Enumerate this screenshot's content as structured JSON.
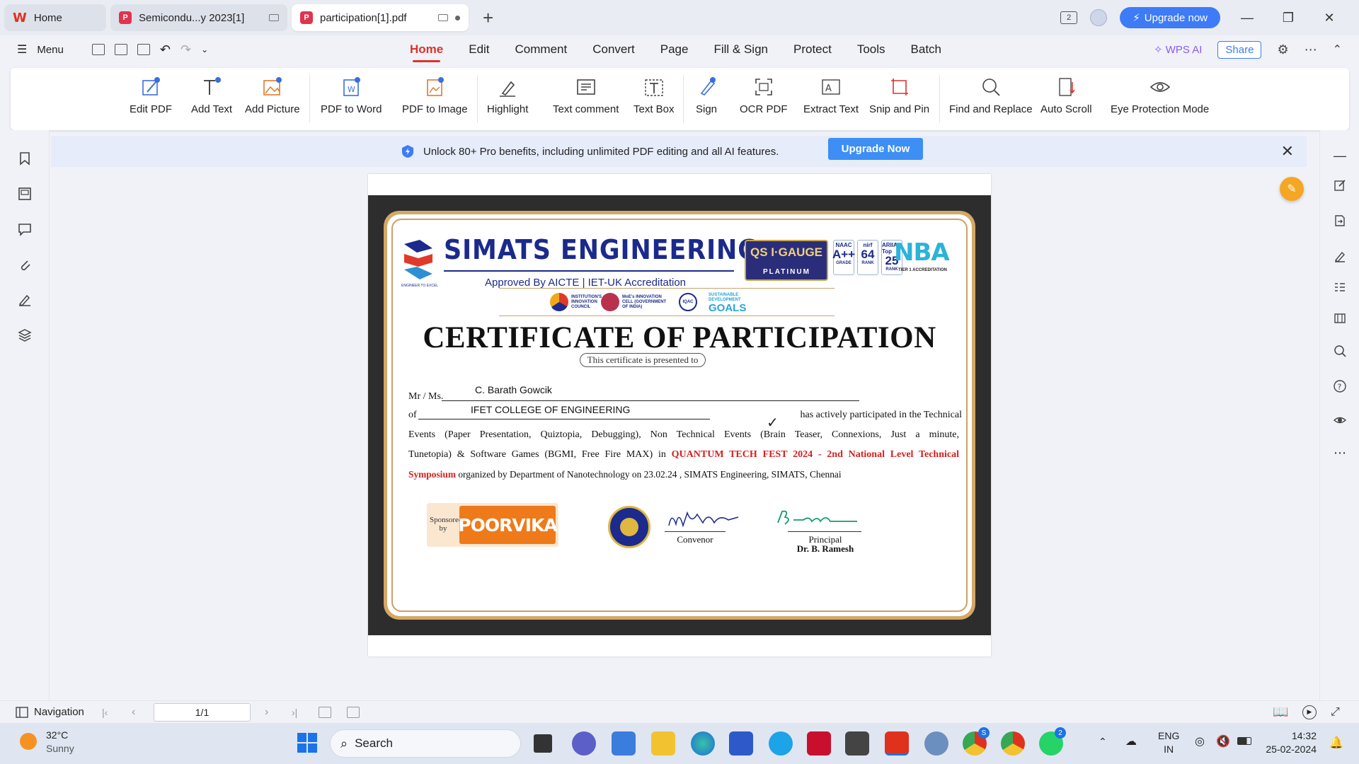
{
  "tabs": [
    {
      "label": "Home"
    },
    {
      "label": "Semicondu...y 2023[1]"
    },
    {
      "label": "participation[1].pdf"
    }
  ],
  "titlebar": {
    "upgrade_label": "Upgrade now",
    "badge": "2"
  },
  "menu": {
    "menu_label": "Menu",
    "tabs": [
      "Home",
      "Edit",
      "Comment",
      "Convert",
      "Page",
      "Fill & Sign",
      "Protect",
      "Tools",
      "Batch"
    ],
    "active_tab": "Home",
    "wps_ai": "WPS AI",
    "share": "Share"
  },
  "ribbon": {
    "items": [
      "Edit PDF",
      "Add Text",
      "Add Picture",
      "PDF to Word",
      "PDF to Image",
      "Highlight",
      "Text comment",
      "Text Box",
      "Sign",
      "OCR PDF",
      "Extract Text",
      "Snip and Pin",
      "Find and Replace",
      "Auto Scroll",
      "Eye Protection Mode"
    ]
  },
  "banner": {
    "text": "Unlock 80+ Pro benefits, including unlimited PDF editing and all AI features.",
    "button": "Upgrade Now"
  },
  "certificate": {
    "org_title": "SIMATS ENGINEERING",
    "org_sub": "Approved By AICTE | IET-UK Accreditation",
    "logo_tag": "ENGINEER TO EXCEL",
    "qs_top": "QS I·GAUGE",
    "qs_bottom": "PLATINUM",
    "rank_naac": {
      "a": "NAAC",
      "b": "A++",
      "c": "GRADE"
    },
    "rank_nirf": {
      "a": "nirf",
      "b": "64",
      "c": "RANK"
    },
    "rank_ariia": {
      "a": "ARIIA Top",
      "b": "25",
      "c": "RANK"
    },
    "nba": "NBA",
    "nba_sub": "TIER 1 ACCREDITATION",
    "strip_iic": "INSTITUTION'S INNOVATION COUNCIL",
    "strip_moe": "MoE's INNOVATION CELL (GOVERNMENT OF INDIA)",
    "strip_iqac": "IQAC",
    "strip_sdg_top": "SUSTAINABLE DEVELOPMENT",
    "strip_sdg_goals": "GOALS",
    "title": "CERTIFICATE OF PARTICIPATION",
    "presented": "This certificate is presented to",
    "mr_label": "Mr / Ms.",
    "name": "C. Barath Gowcik",
    "of_label": "of",
    "college": "IFET COLLEGE OF ENGINEERING",
    "line1_tail": "has actively participated in the Technical",
    "line2": "Events (Paper Presentation, Quiztopia, Debugging), Non Technical Events (Brain Teaser, Connexions, Just a minute,",
    "line3_pre": "Tunetopia) & Software Games (BGMI, Free Fire MAX) in ",
    "line3_red": "QUANTUM TECH FEST 2024 - 2nd National Level Technical",
    "line4_red": "Symposium",
    "line4_tail": " organized by Department of  Nanotechnology on 23.02.24 , SIMATS Engineering, SIMATS, Chennai",
    "sponsored_by": "Sponsored by",
    "sponsor_name": "POORVIKA",
    "convenor": "Convenor",
    "principal": "Principal",
    "principal_name": "Dr. B. Ramesh"
  },
  "statusbar": {
    "navigation": "Navigation",
    "page": "1/1"
  },
  "taskbar": {
    "temp": "32°C",
    "weather": "Sunny",
    "search": "Search",
    "lang1": "ENG",
    "lang2": "IN",
    "time": "14:32",
    "date": "25-02-2024",
    "teams_badge": "2",
    "skype_badge": "S"
  },
  "colors": {
    "accent": "#d9342b",
    "brand_blue": "#3d7bf7",
    "cert_navy": "#1b2a8c",
    "cert_gold": "#d4a867",
    "red_text": "#d41f1f"
  }
}
